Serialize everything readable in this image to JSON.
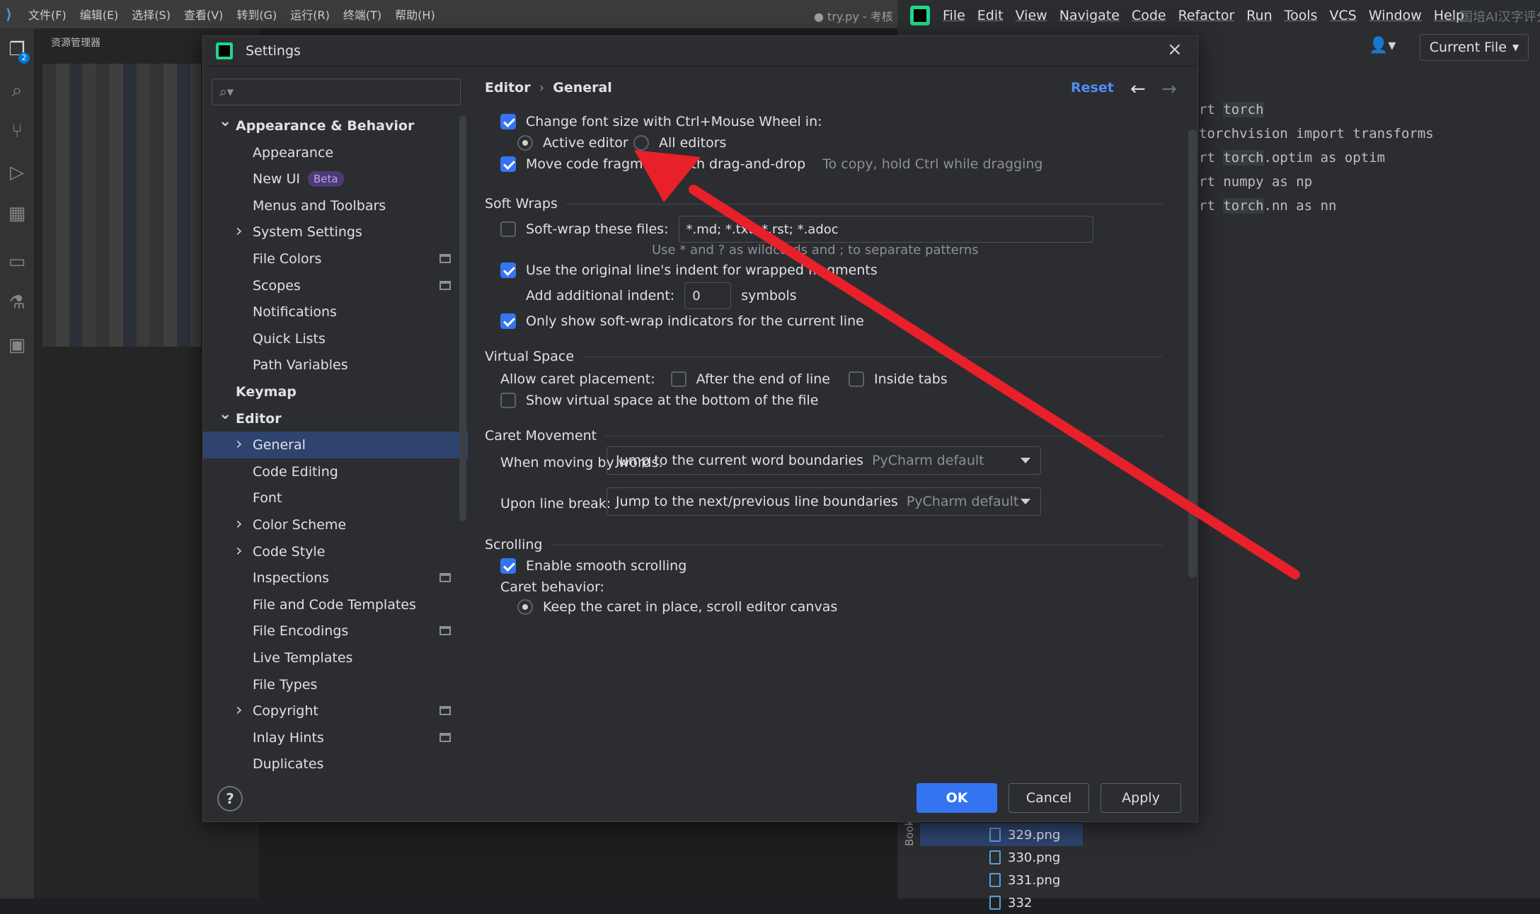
{
  "vscode": {
    "menu": [
      "文件(F)",
      "编辑(E)",
      "选择(S)",
      "查看(V)",
      "转到(G)",
      "运行(R)",
      "终端(T)",
      "帮助(H)"
    ],
    "title": "● try.py - 考核 - V",
    "explorer_title": "资源管理器",
    "badge": "2"
  },
  "pycharm": {
    "menu": [
      "File",
      "Edit",
      "View",
      "Navigate",
      "Code",
      "Refactor",
      "Run",
      "Tools",
      "VCS",
      "Window",
      "Help"
    ],
    "right_title": "国培AI汉字评分",
    "current_file": "Current File",
    "code": [
      [
        "rt ",
        "torch",
        ""
      ],
      [
        "torchvision import transforms",
        "",
        ""
      ],
      [
        "rt ",
        "torch",
        ".optim as optim"
      ],
      [
        "rt numpy as np",
        "",
        ""
      ],
      [
        "rt ",
        "torch",
        ".nn as nn"
      ]
    ],
    "files": [
      "329.png",
      "330.png",
      "331.png",
      "332"
    ],
    "bookmarks": "Bookmarks"
  },
  "dialog": {
    "title": "Settings",
    "search_placeholder": "",
    "tree": [
      {
        "label": "Appearance & Behavior",
        "bold": true,
        "level": 0,
        "chevron": "down"
      },
      {
        "label": "Appearance",
        "level": 1
      },
      {
        "label": "New UI",
        "level": 1,
        "badge": "Beta"
      },
      {
        "label": "Menus and Toolbars",
        "level": 1
      },
      {
        "label": "System Settings",
        "level": 1,
        "chevron": "right"
      },
      {
        "label": "File Colors",
        "level": 1,
        "proj": true
      },
      {
        "label": "Scopes",
        "level": 1,
        "proj": true
      },
      {
        "label": "Notifications",
        "level": 1
      },
      {
        "label": "Quick Lists",
        "level": 1
      },
      {
        "label": "Path Variables",
        "level": 1
      },
      {
        "label": "Keymap",
        "bold": true,
        "level": 0
      },
      {
        "label": "Editor",
        "bold": true,
        "level": 0,
        "chevron": "down"
      },
      {
        "label": "General",
        "level": 1,
        "chevron": "right",
        "selected": true
      },
      {
        "label": "Code Editing",
        "level": 1
      },
      {
        "label": "Font",
        "level": 1
      },
      {
        "label": "Color Scheme",
        "level": 1,
        "chevron": "right"
      },
      {
        "label": "Code Style",
        "level": 1,
        "chevron": "right"
      },
      {
        "label": "Inspections",
        "level": 1,
        "proj": true
      },
      {
        "label": "File and Code Templates",
        "level": 1
      },
      {
        "label": "File Encodings",
        "level": 1,
        "proj": true
      },
      {
        "label": "Live Templates",
        "level": 1
      },
      {
        "label": "File Types",
        "level": 1
      },
      {
        "label": "Copyright",
        "level": 1,
        "chevron": "right",
        "proj": true
      },
      {
        "label": "Inlay Hints",
        "level": 1,
        "proj": true
      },
      {
        "label": "Duplicates",
        "level": 1
      }
    ],
    "breadcrumb": [
      "Editor",
      "General"
    ],
    "breadcrumb_sep": "›",
    "reset": "Reset",
    "content": {
      "font_wheel": "Change font size with Ctrl+Mouse Wheel in:",
      "active_editor": "Active editor",
      "all_editors": "All editors",
      "move_code": "Move code fragments with drag-and-drop",
      "move_hint": "To copy, hold Ctrl while dragging",
      "soft_wraps": "Soft Wraps",
      "soft_wrap_files": "Soft-wrap these files:",
      "soft_wrap_value": "*.md; *.txt; *.rst; *.adoc",
      "wildcard_hint": "Use * and ? as wildcards and ; to separate patterns",
      "original_indent": "Use the original line's indent for wrapped fragments",
      "add_indent": "Add additional indent:",
      "indent_value": "0",
      "symbols": "symbols",
      "only_show": "Only show soft-wrap indicators for the current line",
      "virtual_space": "Virtual Space",
      "allow_caret": "Allow caret placement:",
      "after_end": "After the end of line",
      "inside_tabs": "Inside tabs",
      "show_virtual": "Show virtual space at the bottom of the file",
      "caret_movement": "Caret Movement",
      "moving_words": "When moving by words:",
      "moving_words_value": "Jump to the current word boundaries",
      "moving_words_default": "PyCharm default",
      "line_break": "Upon line break:",
      "line_break_value": "Jump to the next/previous line boundaries",
      "line_break_default": "PyCharm default",
      "scrolling": "Scrolling",
      "smooth": "Enable smooth scrolling",
      "caret_behavior": "Caret behavior:",
      "keep_caret": "Keep the caret in place, scroll editor canvas"
    },
    "buttons": {
      "ok": "OK",
      "cancel": "Cancel",
      "apply": "Apply",
      "help": "?"
    }
  },
  "annotation": {
    "arrow_color": "#e8202a"
  }
}
